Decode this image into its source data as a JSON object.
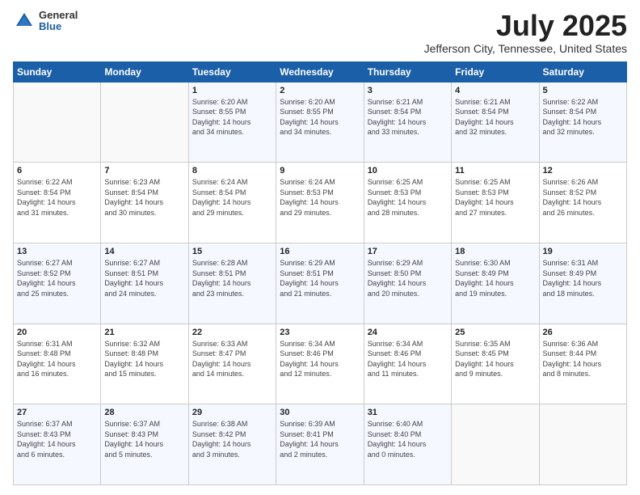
{
  "logo": {
    "general": "General",
    "blue": "Blue"
  },
  "header": {
    "title": "July 2025",
    "subtitle": "Jefferson City, Tennessee, United States"
  },
  "weekdays": [
    "Sunday",
    "Monday",
    "Tuesday",
    "Wednesday",
    "Thursday",
    "Friday",
    "Saturday"
  ],
  "weeks": [
    [
      {
        "day": "",
        "info": ""
      },
      {
        "day": "",
        "info": ""
      },
      {
        "day": "1",
        "info": "Sunrise: 6:20 AM\nSunset: 8:55 PM\nDaylight: 14 hours\nand 34 minutes."
      },
      {
        "day": "2",
        "info": "Sunrise: 6:20 AM\nSunset: 8:55 PM\nDaylight: 14 hours\nand 34 minutes."
      },
      {
        "day": "3",
        "info": "Sunrise: 6:21 AM\nSunset: 8:54 PM\nDaylight: 14 hours\nand 33 minutes."
      },
      {
        "day": "4",
        "info": "Sunrise: 6:21 AM\nSunset: 8:54 PM\nDaylight: 14 hours\nand 32 minutes."
      },
      {
        "day": "5",
        "info": "Sunrise: 6:22 AM\nSunset: 8:54 PM\nDaylight: 14 hours\nand 32 minutes."
      }
    ],
    [
      {
        "day": "6",
        "info": "Sunrise: 6:22 AM\nSunset: 8:54 PM\nDaylight: 14 hours\nand 31 minutes."
      },
      {
        "day": "7",
        "info": "Sunrise: 6:23 AM\nSunset: 8:54 PM\nDaylight: 14 hours\nand 30 minutes."
      },
      {
        "day": "8",
        "info": "Sunrise: 6:24 AM\nSunset: 8:54 PM\nDaylight: 14 hours\nand 29 minutes."
      },
      {
        "day": "9",
        "info": "Sunrise: 6:24 AM\nSunset: 8:53 PM\nDaylight: 14 hours\nand 29 minutes."
      },
      {
        "day": "10",
        "info": "Sunrise: 6:25 AM\nSunset: 8:53 PM\nDaylight: 14 hours\nand 28 minutes."
      },
      {
        "day": "11",
        "info": "Sunrise: 6:25 AM\nSunset: 8:53 PM\nDaylight: 14 hours\nand 27 minutes."
      },
      {
        "day": "12",
        "info": "Sunrise: 6:26 AM\nSunset: 8:52 PM\nDaylight: 14 hours\nand 26 minutes."
      }
    ],
    [
      {
        "day": "13",
        "info": "Sunrise: 6:27 AM\nSunset: 8:52 PM\nDaylight: 14 hours\nand 25 minutes."
      },
      {
        "day": "14",
        "info": "Sunrise: 6:27 AM\nSunset: 8:51 PM\nDaylight: 14 hours\nand 24 minutes."
      },
      {
        "day": "15",
        "info": "Sunrise: 6:28 AM\nSunset: 8:51 PM\nDaylight: 14 hours\nand 23 minutes."
      },
      {
        "day": "16",
        "info": "Sunrise: 6:29 AM\nSunset: 8:51 PM\nDaylight: 14 hours\nand 21 minutes."
      },
      {
        "day": "17",
        "info": "Sunrise: 6:29 AM\nSunset: 8:50 PM\nDaylight: 14 hours\nand 20 minutes."
      },
      {
        "day": "18",
        "info": "Sunrise: 6:30 AM\nSunset: 8:49 PM\nDaylight: 14 hours\nand 19 minutes."
      },
      {
        "day": "19",
        "info": "Sunrise: 6:31 AM\nSunset: 8:49 PM\nDaylight: 14 hours\nand 18 minutes."
      }
    ],
    [
      {
        "day": "20",
        "info": "Sunrise: 6:31 AM\nSunset: 8:48 PM\nDaylight: 14 hours\nand 16 minutes."
      },
      {
        "day": "21",
        "info": "Sunrise: 6:32 AM\nSunset: 8:48 PM\nDaylight: 14 hours\nand 15 minutes."
      },
      {
        "day": "22",
        "info": "Sunrise: 6:33 AM\nSunset: 8:47 PM\nDaylight: 14 hours\nand 14 minutes."
      },
      {
        "day": "23",
        "info": "Sunrise: 6:34 AM\nSunset: 8:46 PM\nDaylight: 14 hours\nand 12 minutes."
      },
      {
        "day": "24",
        "info": "Sunrise: 6:34 AM\nSunset: 8:46 PM\nDaylight: 14 hours\nand 11 minutes."
      },
      {
        "day": "25",
        "info": "Sunrise: 6:35 AM\nSunset: 8:45 PM\nDaylight: 14 hours\nand 9 minutes."
      },
      {
        "day": "26",
        "info": "Sunrise: 6:36 AM\nSunset: 8:44 PM\nDaylight: 14 hours\nand 8 minutes."
      }
    ],
    [
      {
        "day": "27",
        "info": "Sunrise: 6:37 AM\nSunset: 8:43 PM\nDaylight: 14 hours\nand 6 minutes."
      },
      {
        "day": "28",
        "info": "Sunrise: 6:37 AM\nSunset: 8:43 PM\nDaylight: 14 hours\nand 5 minutes."
      },
      {
        "day": "29",
        "info": "Sunrise: 6:38 AM\nSunset: 8:42 PM\nDaylight: 14 hours\nand 3 minutes."
      },
      {
        "day": "30",
        "info": "Sunrise: 6:39 AM\nSunset: 8:41 PM\nDaylight: 14 hours\nand 2 minutes."
      },
      {
        "day": "31",
        "info": "Sunrise: 6:40 AM\nSunset: 8:40 PM\nDaylight: 14 hours\nand 0 minutes."
      },
      {
        "day": "",
        "info": ""
      },
      {
        "day": "",
        "info": ""
      }
    ]
  ]
}
